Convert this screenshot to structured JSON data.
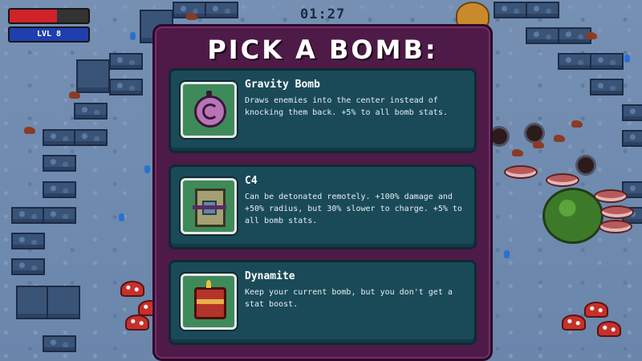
{
  "hud": {
    "health_fraction": 0.6,
    "level_label": "LVL 8",
    "timer": "01:27"
  },
  "dialog": {
    "title": "PICK A BOMB:",
    "options": [
      {
        "name": "Gravity Bomb",
        "description": "Draws enemies into the center instead of knocking them back. +5% to all bomb stats.",
        "icon": "gravity-bomb-icon"
      },
      {
        "name": "C4",
        "description": "Can be detonated remotely. +100% damage and +50% radius, but 30% slower to charge. +5% to all bomb stats.",
        "icon": "c4-icon"
      },
      {
        "name": "Dynamite",
        "description": "Keep your current bomb, but you don't get a stat boost.",
        "icon": "dynamite-icon"
      }
    ]
  },
  "colors": {
    "dialog_bg": "#4e1a47",
    "option_bg": "#1a4a58",
    "health": "#d0222a",
    "level": "#1f3fae"
  }
}
